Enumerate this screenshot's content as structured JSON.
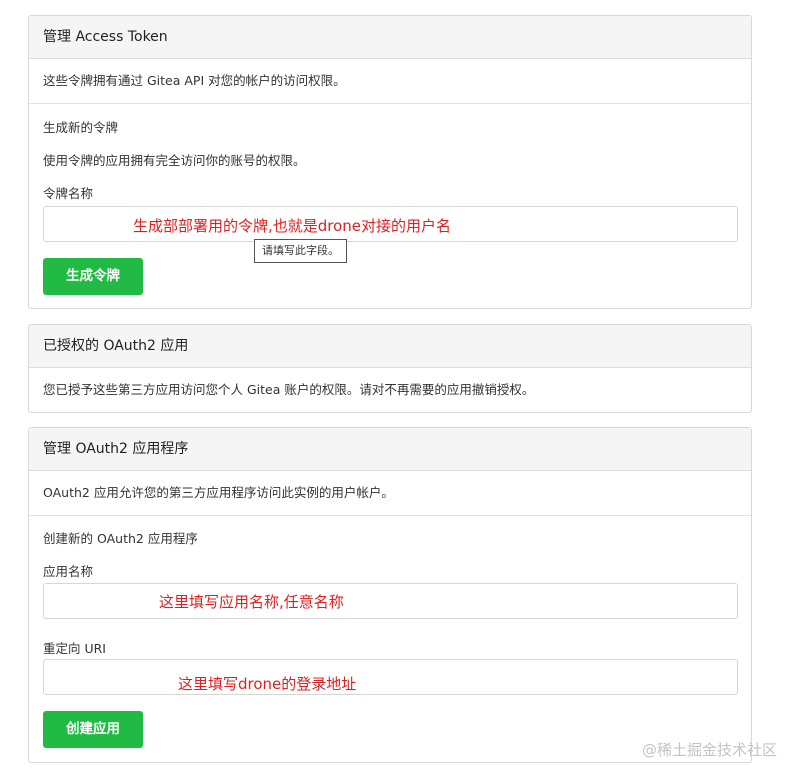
{
  "access_token": {
    "header": "管理 Access Token",
    "description": "这些令牌拥有通过 Gitea API 对您的帐户的访问权限。",
    "generate_title": "生成新的令牌",
    "generate_desc": "使用令牌的应用拥有完全访问你的账号的权限。",
    "token_name_label": "令牌名称",
    "token_name_value": "",
    "annotation": "生成部部署用的令牌,也就是drone对接的用户名",
    "tooltip": "请填写此字段。",
    "button": "生成令牌"
  },
  "authorized_oauth2": {
    "header": "已授权的 OAuth2 应用",
    "description": "您已授予这些第三方应用访问您个人 Gitea 账户的权限。请对不再需要的应用撤销授权。"
  },
  "manage_oauth2": {
    "header": "管理 OAuth2 应用程序",
    "description": "OAuth2 应用允许您的第三方应用程序访问此实例的用户帐户。",
    "create_title": "创建新的 OAuth2 应用程序",
    "app_name_label": "应用名称",
    "app_name_value": "",
    "app_name_annotation": "这里填写应用名称,任意名称",
    "redirect_label": "重定向 URI",
    "redirect_value": "",
    "redirect_annotation": "这里填写drone的登录地址",
    "button": "创建应用"
  },
  "watermark": "@稀土掘金技术社区",
  "colors": {
    "button": "#21ba45",
    "annotation": "#e02020"
  }
}
